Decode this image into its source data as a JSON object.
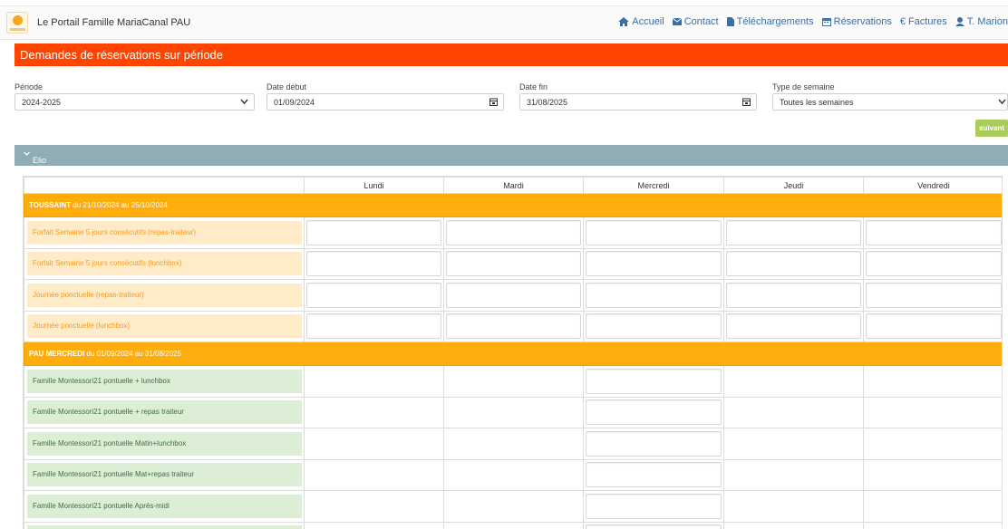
{
  "navbar": {
    "brand": "Le Portail Famille MariaCanal PAU",
    "links": [
      {
        "icon": "home-icon",
        "label": "Accueil"
      },
      {
        "icon": "envelope-icon",
        "label": "Contact"
      },
      {
        "icon": "file-icon",
        "label": "Téléchargements"
      },
      {
        "icon": "calendar-icon",
        "label": "Réservations"
      },
      {
        "icon": "euro-icon",
        "label": "Factures"
      },
      {
        "icon": "user-icon",
        "label": "T. Marion"
      }
    ]
  },
  "page": {
    "title": "Demandes de réservations sur période",
    "accent": "#ff4500"
  },
  "filters": {
    "periode": {
      "label": "Période",
      "value": "2024-2025"
    },
    "date_debut": {
      "label": "Date début",
      "value": "01/09/2024"
    },
    "date_fin": {
      "label": "Date fin",
      "value": "31/08/2025"
    },
    "type_semaine": {
      "label": "Type de semaine",
      "value": "Toutes les semaines"
    }
  },
  "next_button": "suivant",
  "child": {
    "name": "Elio",
    "icon": "chevron-down-icon"
  },
  "table": {
    "days": [
      "Lundi",
      "Mardi",
      "Mercredi",
      "Jeudi",
      "Vendredi"
    ],
    "sections": [
      {
        "name": "TOUSSAINT",
        "range": " du 21/10/2024 au 25/10/2024",
        "style": "orange",
        "rows": [
          {
            "label": "Forfait Semaine 5 jours consécutifs (repas-traiteur)",
            "inputs": [
              true,
              true,
              true,
              true,
              true
            ]
          },
          {
            "label": "Forfait Semaine 5 jours consécutifs (lunchbox)",
            "inputs": [
              true,
              true,
              true,
              true,
              true
            ]
          },
          {
            "label": "Journée ponctuelle (repas-traiteur)",
            "inputs": [
              true,
              true,
              true,
              true,
              true
            ]
          },
          {
            "label": "Journée ponctuelle (lunchbox)",
            "inputs": [
              true,
              true,
              true,
              true,
              true
            ]
          }
        ]
      },
      {
        "name": "PAU MERCREDI",
        "range": " du 01/09/2024 au 31/08/2025",
        "style": "green",
        "rows": [
          {
            "label": "Famille Montessori21 pontuelle + lunchbox",
            "inputs": [
              false,
              false,
              true,
              false,
              false
            ]
          },
          {
            "label": "Famille Montessori21 pontuelle + repas traiteur",
            "inputs": [
              false,
              false,
              true,
              false,
              false
            ]
          },
          {
            "label": "Famille Montessori21 pontuelle Matin+lunchbox",
            "inputs": [
              false,
              false,
              true,
              false,
              false
            ]
          },
          {
            "label": "Famille Montessori21 pontuelle Mat+repas traiteur",
            "inputs": [
              false,
              false,
              true,
              false,
              false
            ]
          },
          {
            "label": "Famille Montessori21 pontuelle Après-midi",
            "inputs": [
              false,
              false,
              true,
              false,
              false
            ]
          },
          {
            "label": "",
            "inputs": [
              false,
              false,
              true,
              false,
              false
            ]
          }
        ]
      }
    ]
  }
}
